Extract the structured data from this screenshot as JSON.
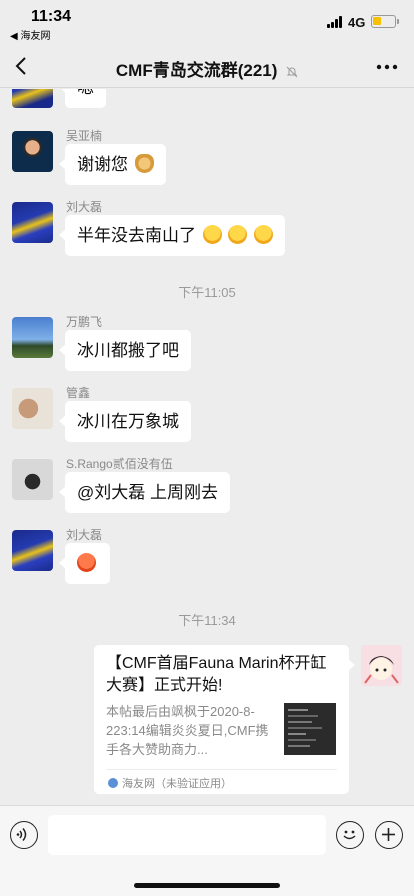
{
  "status": {
    "time": "11:34",
    "back_app": "◀ 海友网",
    "network": "4G"
  },
  "nav": {
    "title": "CMF青岛交流群(221)"
  },
  "messages": [
    {
      "sender": "",
      "text": "嗯"
    },
    {
      "sender": "吴亚楠",
      "text": "谢谢您"
    },
    {
      "sender": "刘大磊",
      "text": "半年没去南山了"
    },
    {
      "time": "下午11:05"
    },
    {
      "sender": "万鹏飞",
      "text": "冰川都搬了吧"
    },
    {
      "sender": "管鑫",
      "text": "冰川在万象城"
    },
    {
      "sender": "S.Rango贰佰没有伍",
      "text": "@刘大磊 上周刚去"
    },
    {
      "sender": "刘大磊",
      "text": ""
    },
    {
      "time": "下午11:34"
    }
  ],
  "link_card": {
    "title": "【CMF首届Fauna Marin杯开缸大赛】正式开始!",
    "description": "本帖最后由飒枫于2020-8-223:14编辑炎炎夏日,CMF携手各大赞助商力...",
    "source": "海友网（未验证应用）"
  },
  "colors": {
    "background": "#ededed",
    "bubble": "#ffffff",
    "battery": "#f7c100"
  }
}
